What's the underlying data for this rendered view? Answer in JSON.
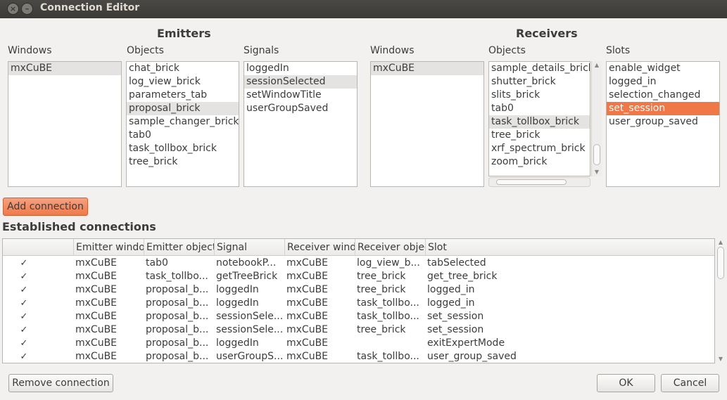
{
  "window": {
    "title": "Connection Editor",
    "close_glyph": "×",
    "min_glyph": "–"
  },
  "emitters": {
    "title": "Emitters",
    "windows_label": "Windows",
    "objects_label": "Objects",
    "signals_label": "Signals",
    "windows": [
      "mxCuBE"
    ],
    "objects": [
      "chat_brick",
      "log_view_brick",
      "parameters_tab",
      "proposal_brick",
      "sample_changer_brick",
      "tab0",
      "task_tollbox_brick",
      "tree_brick"
    ],
    "signals": [
      "loggedIn",
      "sessionSelected",
      "setWindowTitle",
      "userGroupSaved"
    ]
  },
  "receivers": {
    "title": "Receivers",
    "windows_label": "Windows",
    "objects_label": "Objects",
    "slots_label": "Slots",
    "windows": [
      "mxCuBE"
    ],
    "objects": [
      "sample_details_brick",
      "shutter_brick",
      "slits_brick",
      "tab0",
      "task_tollbox_brick",
      "tree_brick",
      "xrf_spectrum_brick",
      "zoom_brick"
    ],
    "slots": [
      "enable_widget",
      "logged_in",
      "selection_changed",
      "set_session",
      "user_group_saved"
    ]
  },
  "add_connection_label": "Add connection",
  "established": {
    "title": "Established connections",
    "headers": [
      "",
      "Emitter window",
      "Emitter object",
      "Signal",
      "Receiver window",
      "Receiver object",
      "Slot"
    ],
    "check_glyph": "✓",
    "rows": [
      [
        "mxCuBE",
        "tab0",
        "notebookP...",
        "mxCuBE",
        "log_view_b...",
        "tabSelected"
      ],
      [
        "mxCuBE",
        "task_tollbo...",
        "getTreeBrick",
        "mxCuBE",
        "tree_brick",
        "get_tree_brick"
      ],
      [
        "mxCuBE",
        "proposal_b...",
        "loggedIn",
        "mxCuBE",
        "tree_brick",
        "logged_in"
      ],
      [
        "mxCuBE",
        "proposal_b...",
        "loggedIn",
        "mxCuBE",
        "task_tollbo...",
        "logged_in"
      ],
      [
        "mxCuBE",
        "proposal_b...",
        "sessionSele...",
        "mxCuBE",
        "task_tollbo...",
        "set_session"
      ],
      [
        "mxCuBE",
        "proposal_b...",
        "sessionSele...",
        "mxCuBE",
        "tree_brick",
        "set_session"
      ],
      [
        "mxCuBE",
        "proposal_b...",
        "loggedIn",
        "mxCuBE",
        "",
        "exitExpertMode"
      ],
      [
        "mxCuBE",
        "proposal_b...",
        "userGroupS...",
        "mxCuBE",
        "task_tollbo...",
        "user_group_saved"
      ]
    ]
  },
  "buttons": {
    "remove": "Remove connection",
    "ok": "OK",
    "cancel": "Cancel"
  },
  "colors": {
    "accent": "#f07746",
    "selection_gray": "#e4e3e1",
    "titlebar": "#3b3a36"
  }
}
